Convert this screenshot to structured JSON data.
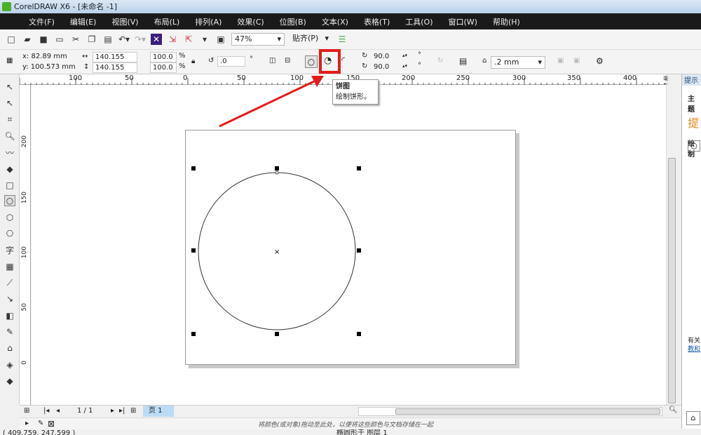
{
  "title": "CorelDRAW X6 - [未命名 -1]",
  "menu": [
    "文件(F)",
    "编辑(E)",
    "视图(V)",
    "布局(L)",
    "排列(A)",
    "效果(C)",
    "位图(B)",
    "文本(X)",
    "表格(T)",
    "工具(O)",
    "窗口(W)",
    "帮助(H)"
  ],
  "toolbar": {
    "zoom": "47%",
    "snap": "贴齐(P)"
  },
  "props": {
    "x": "x: 82.89 mm",
    "y": "y: 100.573 mm",
    "w": "140.155 mm",
    "h": "140.155 mm",
    "sx": "100.0",
    "sy": "100.0",
    "pct": "%",
    "angle": ".0",
    "deg": "°",
    "start": "90.0",
    "end": "90.0",
    "outline": ".2 mm"
  },
  "ruler": {
    "h": [
      "100",
      "50",
      "0",
      "50",
      "100",
      "150",
      "200",
      "250",
      "300",
      "350",
      "400"
    ],
    "unit": "毫米",
    "v": [
      "200",
      "150",
      "100",
      "50",
      "0"
    ]
  },
  "tooltip": {
    "title": "饼图",
    "desc": "绘制饼形。"
  },
  "docker": {
    "tab": "提示",
    "t1": "主题",
    "t2": "提",
    "t3": "绘制",
    "more": "有关",
    "link": "教和"
  },
  "pagebar": {
    "count": "1 / 1",
    "tab": "页 1"
  },
  "palette": {
    "hint": "将颜色(或对象)拖动至此处，以便将这些颜色与文档存储在一起"
  },
  "status": {
    "coords": "( 409.759, 247.599 )",
    "info": "椭圆形于 图层 1"
  },
  "colors": {
    "highlight": "#e51b1b",
    "menubar": "#1a1a1a"
  }
}
